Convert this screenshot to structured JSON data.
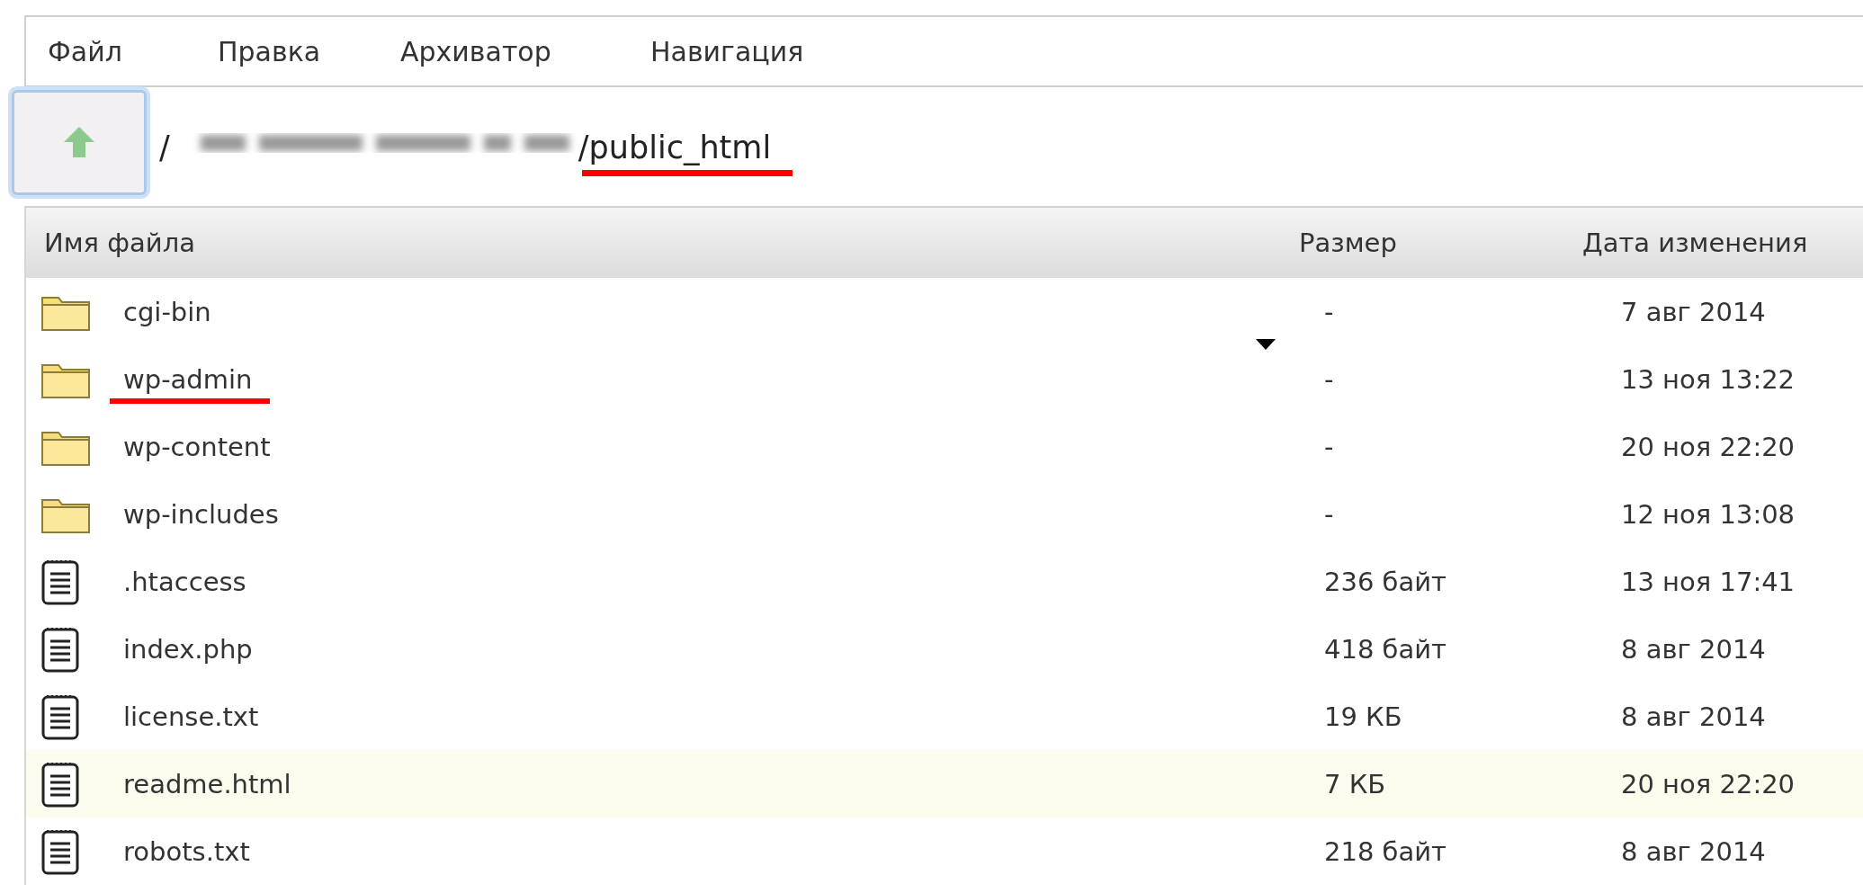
{
  "menu": [
    {
      "label": "Файл"
    },
    {
      "label": "Правка"
    },
    {
      "label": "Архиватор"
    },
    {
      "label": "Навигация"
    }
  ],
  "path": {
    "segments": [
      {
        "kind": "text",
        "text": "/",
        "underlined": false
      },
      {
        "kind": "blurred"
      },
      {
        "kind": "text",
        "text": "/public_html",
        "underlined": true
      }
    ]
  },
  "table": {
    "columns": [
      "Имя файла",
      "Размер",
      "Дата изменения"
    ],
    "rows": [
      {
        "kind": "folder",
        "name": "cgi-bin",
        "size": "-",
        "date": "7 авг 2014",
        "underlined": false,
        "highlighted": false
      },
      {
        "kind": "folder",
        "name": "wp-admin",
        "size": "-",
        "date": "13 ноя 13:22",
        "underlined": true,
        "highlighted": false
      },
      {
        "kind": "folder",
        "name": "wp-content",
        "size": "-",
        "date": "20 ноя 22:20",
        "underlined": false,
        "highlighted": false
      },
      {
        "kind": "folder",
        "name": "wp-includes",
        "size": "-",
        "date": "12 ноя 13:08",
        "underlined": false,
        "highlighted": false
      },
      {
        "kind": "file",
        "name": ".htaccess",
        "size": "236 байт",
        "date": "13 ноя 17:41",
        "underlined": false,
        "highlighted": false
      },
      {
        "kind": "file",
        "name": "index.php",
        "size": "418 байт",
        "date": "8 авг 2014",
        "underlined": false,
        "highlighted": false
      },
      {
        "kind": "file",
        "name": "license.txt",
        "size": "19 КБ",
        "date": "8 авг 2014",
        "underlined": false,
        "highlighted": false
      },
      {
        "kind": "file",
        "name": "readme.html",
        "size": "7 КБ",
        "date": "20 ноя 22:20",
        "underlined": false,
        "highlighted": true
      },
      {
        "kind": "file",
        "name": "robots.txt",
        "size": "218 байт",
        "date": "8 авг 2014",
        "underlined": false,
        "highlighted": false
      }
    ]
  }
}
